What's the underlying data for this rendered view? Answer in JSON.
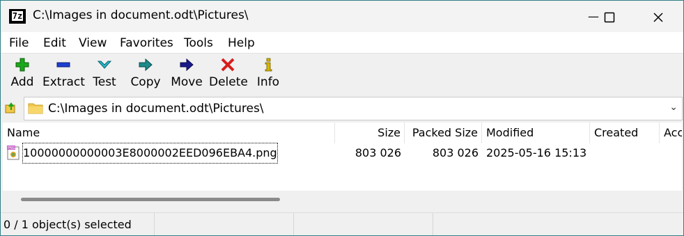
{
  "window": {
    "title": "C:\\Images in document.odt\\Pictures\\",
    "app_icon_text": "7z",
    "controls": {
      "minimize": "—",
      "maximize": "☐",
      "close": "✕"
    }
  },
  "menu": [
    "File",
    "Edit",
    "View",
    "Favorites",
    "Tools",
    "Help"
  ],
  "toolbar": {
    "add": "Add",
    "extract": "Extract",
    "test": "Test",
    "copy": "Copy",
    "move": "Move",
    "delete": "Delete",
    "info": "Info"
  },
  "address": {
    "path": "C:\\Images in document.odt\\Pictures\\",
    "dropdown": "⌄"
  },
  "columns": {
    "name": "Name",
    "size": "Size",
    "packed": "Packed Size",
    "modified": "Modified",
    "created": "Created",
    "accessed": "Acc"
  },
  "files": [
    {
      "name": "10000000000003E8000002EED096EBA4.png",
      "size": "803 026",
      "packed": "803 026",
      "modified": "2025-05-16 15:13",
      "created": "",
      "icon": "png-file-icon"
    }
  ],
  "status": {
    "selection": "0 / 1 object(s) selected"
  },
  "colors": {
    "add": "#1aa81a",
    "extract": "#1c3fcf",
    "test": "#25b8c8",
    "copy": "#1e8a8a",
    "move": "#1a1a8c",
    "delete": "#d71c1c",
    "info": "#d8b400",
    "folder": "#f3c94a"
  }
}
